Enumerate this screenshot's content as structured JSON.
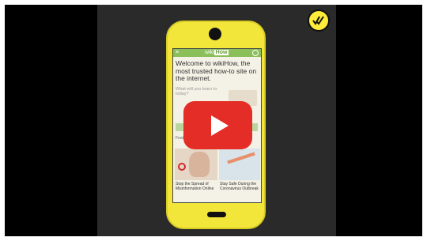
{
  "colors": {
    "phone": "#f3e63a",
    "play_button": "#e52d27",
    "header_green": "#8bbf5a",
    "badge": "#ffec3a"
  },
  "badge_icon": "double-checkmark-icon",
  "screen": {
    "menu_glyph": "≡",
    "brand_wiki": "wiki",
    "brand_how": "How",
    "welcome_text": "Welcome to wikiHow, the most trusted how-to site on the internet.",
    "question_text": "What will you learn to today?",
    "section_caption": "Featured Articles",
    "articles": [
      {
        "title": "Stop the Spread of Misinformation Online"
      },
      {
        "title": "Stay Safe During the Coronavirus Outbreak"
      }
    ]
  },
  "player": {
    "play_icon": "play-icon"
  }
}
